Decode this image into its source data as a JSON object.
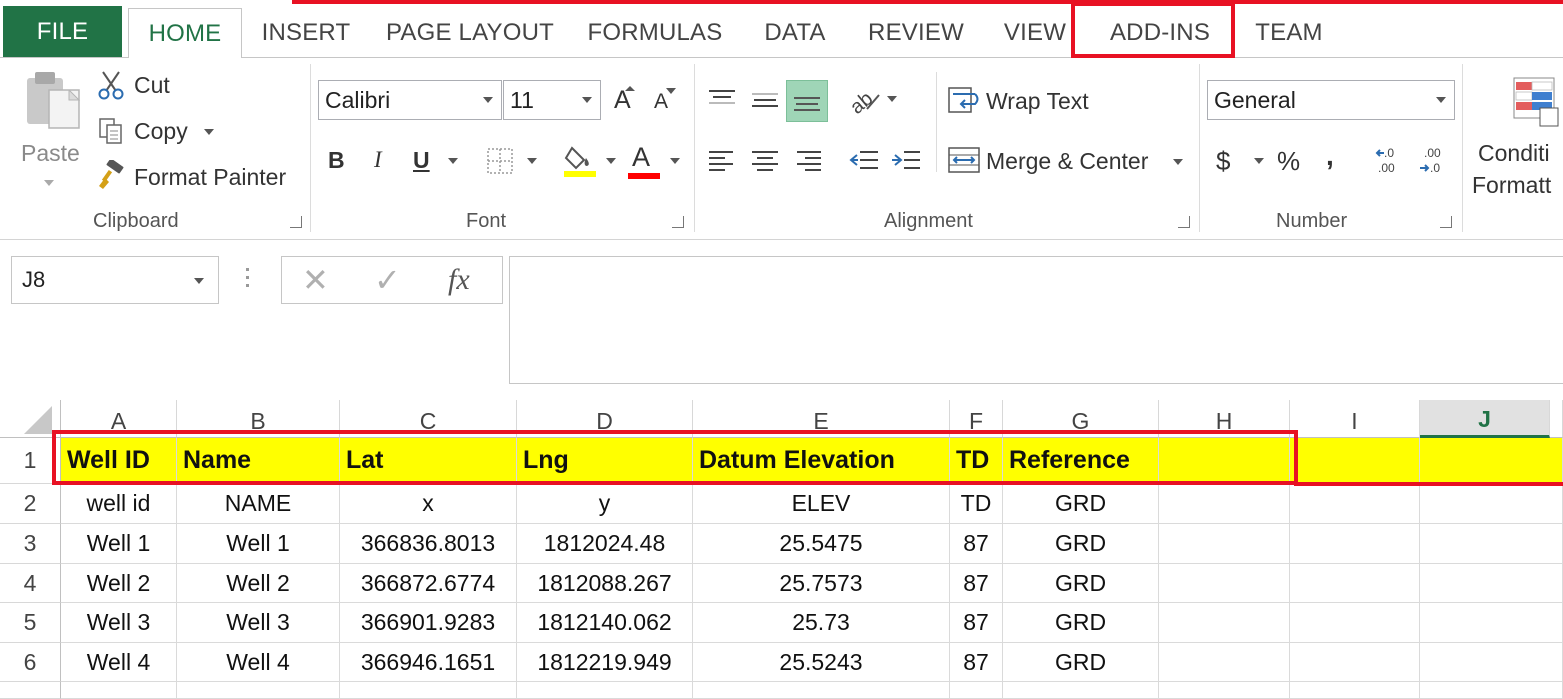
{
  "tabs": {
    "file": "FILE",
    "home": "HOME",
    "insert": "INSERT",
    "page_layout": "PAGE LAYOUT",
    "formulas": "FORMULAS",
    "data": "DATA",
    "review": "REVIEW",
    "view": "VIEW",
    "add_ins": "ADD-INS",
    "team": "TEAM"
  },
  "ribbon": {
    "clipboard": {
      "label": "Clipboard",
      "paste": "Paste",
      "cut": "Cut",
      "copy": "Copy",
      "format_painter": "Format Painter"
    },
    "font": {
      "label": "Font",
      "font_name": "Calibri",
      "font_size": "11",
      "bold": "B",
      "italic": "I",
      "underline": "U",
      "grow": "A",
      "shrink": "A",
      "font_color_letter": "A",
      "highlight_color": "#ffff00",
      "font_color": "#ff0000"
    },
    "alignment": {
      "label": "Alignment",
      "wrap_text": "Wrap Text",
      "merge_center": "Merge & Center"
    },
    "number": {
      "label": "Number",
      "format": "General",
      "currency": "$",
      "percent": "%",
      "comma": ","
    },
    "styles": {
      "conditional_formatting_1": "Conditi",
      "conditional_formatting_2": "Formatt"
    }
  },
  "formula_bar": {
    "name_box": "J8",
    "cancel": "✕",
    "enter": "✓",
    "fx": "fx",
    "value": ""
  },
  "grid": {
    "active_column": "J",
    "columns": [
      "A",
      "B",
      "C",
      "D",
      "E",
      "F",
      "G",
      "H",
      "I",
      "J"
    ],
    "row_numbers": [
      "1",
      "2",
      "3",
      "4",
      "5",
      "6"
    ],
    "header_row": [
      "Well ID",
      "Name",
      "Lat",
      "Lng",
      "Datum Elevation",
      "TD",
      "Reference",
      "",
      "",
      ""
    ],
    "rows": [
      [
        "well id",
        "NAME",
        "x",
        "y",
        "ELEV",
        "TD",
        "GRD",
        "",
        "",
        ""
      ],
      [
        "Well 1",
        "Well 1",
        "366836.8013",
        "1812024.48",
        "25.5475",
        "87",
        "GRD",
        "",
        "",
        ""
      ],
      [
        "Well 2",
        "Well 2",
        "366872.6774",
        "1812088.267",
        "25.7573",
        "87",
        "GRD",
        "",
        "",
        ""
      ],
      [
        "Well 3",
        "Well 3",
        "366901.9283",
        "1812140.062",
        "25.73",
        "87",
        "GRD",
        "",
        "",
        ""
      ],
      [
        "Well 4",
        "Well 4",
        "366946.1651",
        "1812219.949",
        "25.5243",
        "87",
        "GRD",
        "",
        "",
        ""
      ]
    ]
  },
  "colors": {
    "excel_green": "#217346",
    "highlight_red": "#e81123",
    "header_yellow": "#ffff00"
  }
}
